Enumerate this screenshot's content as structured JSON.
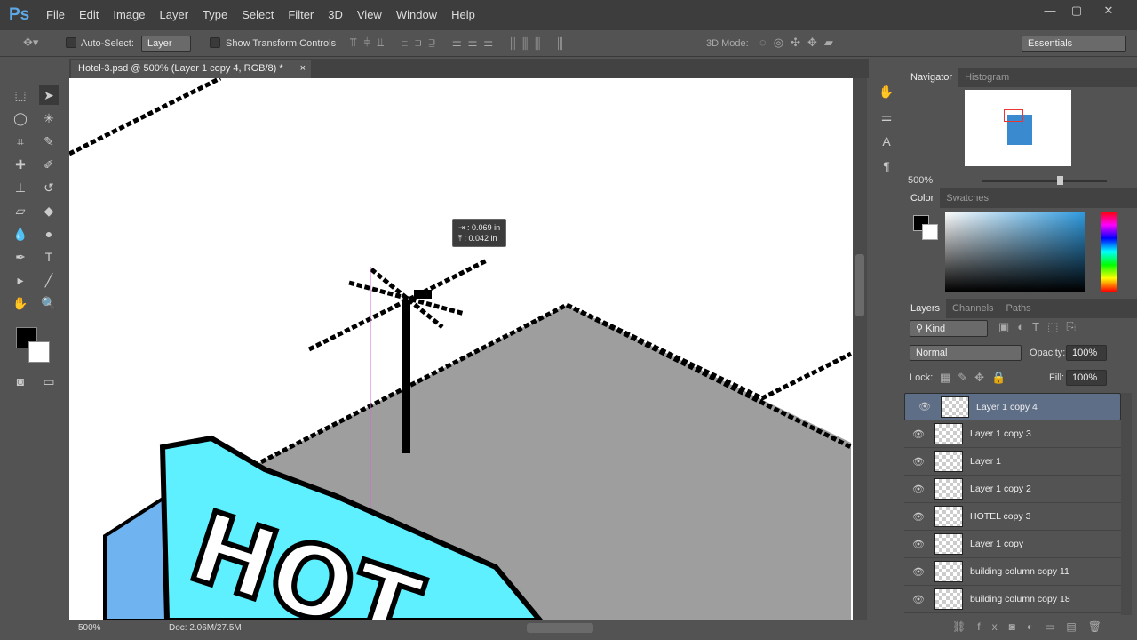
{
  "app": {
    "logo": "Ps",
    "menus": [
      "File",
      "Edit",
      "Image",
      "Layer",
      "Type",
      "Select",
      "Filter",
      "3D",
      "View",
      "Window",
      "Help"
    ],
    "window_buttons": [
      "—",
      "▢",
      "✕"
    ]
  },
  "options": {
    "auto_select_label": "Auto-Select:",
    "auto_select_value": "Layer",
    "show_transform_label": "Show Transform Controls",
    "mode_3d_label": "3D Mode:",
    "workspace": "Essentials"
  },
  "document": {
    "tab_title": "Hotel-3.psd @ 500% (Layer 1 copy 4, RGB/8) *",
    "close": "×"
  },
  "tooltip": {
    "dx": "0.069 in",
    "dy": "0.042 in"
  },
  "status": {
    "zoom": "500%",
    "doc": "Doc: 2.06M/27.5M"
  },
  "navigator": {
    "tabs": [
      "Navigator",
      "Histogram"
    ],
    "zoom": "500%"
  },
  "color": {
    "tabs": [
      "Color",
      "Swatches"
    ],
    "foreground": "#000000",
    "background": "#ffffff"
  },
  "layers": {
    "tabs": [
      "Layers",
      "Channels",
      "Paths"
    ],
    "filter": "Kind",
    "blend_mode": "Normal",
    "opacity_label": "Opacity:",
    "opacity": "100%",
    "lock_label": "Lock:",
    "fill_label": "Fill:",
    "fill": "100%",
    "items": [
      {
        "name": "Layer 1 copy 4",
        "selected": true
      },
      {
        "name": "Layer 1 copy 3"
      },
      {
        "name": "Layer 1"
      },
      {
        "name": "Layer 1 copy 2"
      },
      {
        "name": "HOTEL copy 3"
      },
      {
        "name": "Layer 1 copy"
      },
      {
        "name": "building column copy 11"
      },
      {
        "name": "building column copy 18"
      }
    ]
  }
}
